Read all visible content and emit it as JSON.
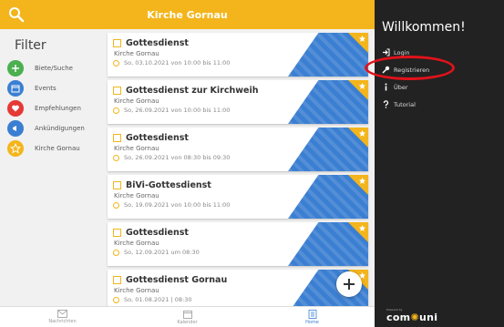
{
  "header": {
    "title": "Kirche Gornau"
  },
  "filter": {
    "title": "Filter",
    "items": [
      {
        "label": "Biete/Suche",
        "icon": "handshake-icon",
        "color": "#4caf50"
      },
      {
        "label": "Events",
        "icon": "calendar-icon",
        "color": "#3b7fd2"
      },
      {
        "label": "Empfehlungen",
        "icon": "heart-icon",
        "color": "#e53935"
      },
      {
        "label": "Ankündigungen",
        "icon": "megaphone-icon",
        "color": "#3b7fd2"
      },
      {
        "label": "Kirche Gornau",
        "icon": "star-icon",
        "color": "#f3b51b"
      }
    ]
  },
  "feed": [
    {
      "title": "Gottesdienst",
      "org": "Kirche Gornau",
      "date": "So, 03.10.2021 von 10:00 bis 11:00"
    },
    {
      "title": "Gottesdienst zur Kirchweih",
      "org": "Kirche Gornau",
      "date": "So, 26.09.2021 von 10:00 bis 11:00"
    },
    {
      "title": "Gottesdienst",
      "org": "Kirche Gornau",
      "date": "So, 26.09.2021 von 08:30 bis 09:30"
    },
    {
      "title": "BiVi-Gottesdienst",
      "org": "Kirche Gornau",
      "date": "So, 19.09.2021 von 10:00 bis 11:00"
    },
    {
      "title": "Gottesdienst",
      "org": "Kirche Gornau",
      "date": "So, 12.09.2021 um 08:30"
    },
    {
      "title": "Gottesdienst Gornau",
      "org": "Kirche Gornau",
      "date": "So, 01.08.2021 | 08:30"
    }
  ],
  "bottom_nav": [
    {
      "label": "Nachrichten",
      "icon": "mail-icon",
      "active": false
    },
    {
      "label": "Kalender",
      "icon": "calendar-icon",
      "active": false
    },
    {
      "label": "Home",
      "icon": "home-icon",
      "active": true
    }
  ],
  "side": {
    "welcome": "Willkommen!",
    "menu": [
      {
        "label": "Login",
        "icon": "login-icon"
      },
      {
        "label": "Registrieren",
        "icon": "key-icon"
      },
      {
        "label": "Über",
        "icon": "info-icon"
      },
      {
        "label": "Tutorial",
        "icon": "help-icon"
      }
    ],
    "brand_prefix": "Powered by",
    "brand_a": "com",
    "brand_b": "uni"
  },
  "colors": {
    "accent": "#f3b51b",
    "blue": "#3b7fd2",
    "sidebar": "#222222",
    "highlight": "#e0121b"
  }
}
